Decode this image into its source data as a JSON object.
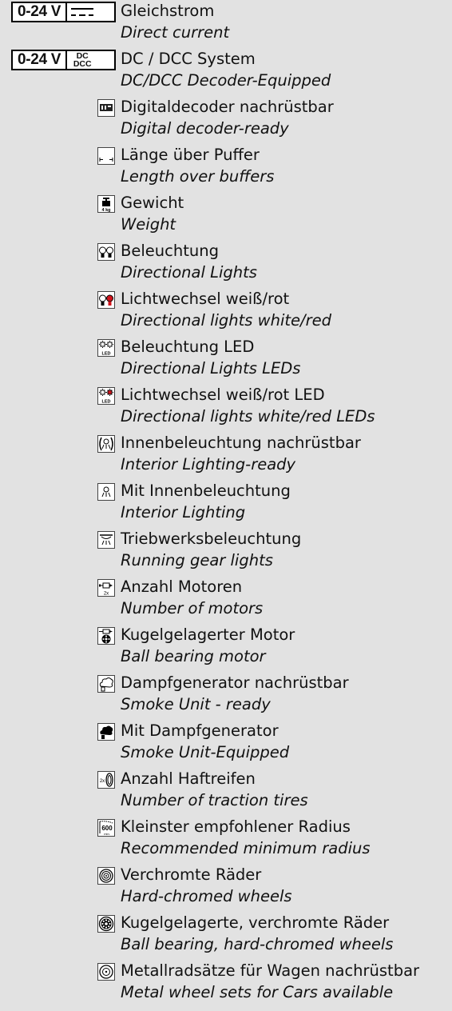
{
  "items": [
    {
      "de": "Gleichstrom",
      "en": "Direct current",
      "icon": "dc-current-icon",
      "badge": "0-24 V"
    },
    {
      "de": "DC / DCC System",
      "en": "DC/DCC Decoder-Equipped",
      "icon": "dc-dcc-system-icon",
      "badge": "0-24 V",
      "badge_sym": [
        "DC",
        "DCC"
      ]
    },
    {
      "de": "Digitaldecoder nachrüstbar",
      "en": "Digital decoder-ready",
      "icon": "digital-decoder-ready-icon"
    },
    {
      "de": "Länge über Puffer",
      "en": "Length over buffers",
      "icon": "length-over-buffers-icon"
    },
    {
      "de": "Gewicht",
      "en": "Weight",
      "icon": "weight-icon",
      "icon_text": "4 kg"
    },
    {
      "de": "Beleuchtung",
      "en": "Directional Lights",
      "icon": "directional-lights-icon"
    },
    {
      "de": "Lichtwechsel weiß/rot",
      "en": "Directional lights white/red",
      "icon": "lights-white-red-icon"
    },
    {
      "de": "Beleuchtung LED",
      "en": "Directional Lights LEDs",
      "icon": "led-lights-icon",
      "icon_text": "LED"
    },
    {
      "de": "Lichtwechsel weiß/rot LED",
      "en": "Directional lights white/red LEDs",
      "icon": "led-lights-white-red-icon",
      "icon_text": "LED"
    },
    {
      "de": "Innenbeleuchtung nachrüstbar",
      "en": "Interior Lighting-ready",
      "icon": "interior-lighting-ready-icon"
    },
    {
      "de": "Mit Innenbeleuchtung",
      "en": "Interior Lighting",
      "icon": "interior-lighting-icon"
    },
    {
      "de": "Triebwerksbeleuchtung",
      "en": "Running gear lights",
      "icon": "running-gear-lights-icon"
    },
    {
      "de": "Anzahl Motoren",
      "en": "Number of motors",
      "icon": "number-of-motors-icon",
      "icon_text": "2x"
    },
    {
      "de": "Kugelgelagerter Motor",
      "en": "Ball bearing motor",
      "icon": "ball-bearing-motor-icon"
    },
    {
      "de": "Dampfgenerator nachrüstbar",
      "en": "Smoke Unit - ready",
      "icon": "smoke-unit-ready-icon"
    },
    {
      "de": "Mit Dampfgenerator",
      "en": "Smoke Unit-Equipped",
      "icon": "smoke-unit-equipped-icon"
    },
    {
      "de": "Anzahl Haftreifen",
      "en": "Number of traction tires",
      "icon": "traction-tires-icon",
      "icon_text": "2x"
    },
    {
      "de": "Kleinster empfohlener Radius",
      "en": "Recommended minimum radius",
      "icon": "minimum-radius-icon",
      "icon_text": "600",
      "icon_subtext": "min."
    },
    {
      "de": "Verchromte Räder",
      "en": "Hard-chromed wheels",
      "icon": "chromed-wheels-icon"
    },
    {
      "de": "Kugelgelagerte, verchromte Räder",
      "en": "Ball bearing, hard-chromed wheels",
      "icon": "ball-bearing-chromed-wheels-icon"
    },
    {
      "de": "Metallradsätze für Wagen nachrüstbar",
      "en": "Metal wheel sets for Cars available",
      "icon": "metal-wheel-sets-icon"
    }
  ],
  "colors": {
    "background": "#e2e2e2",
    "light_red": "#d0141c",
    "text": "#111111"
  }
}
